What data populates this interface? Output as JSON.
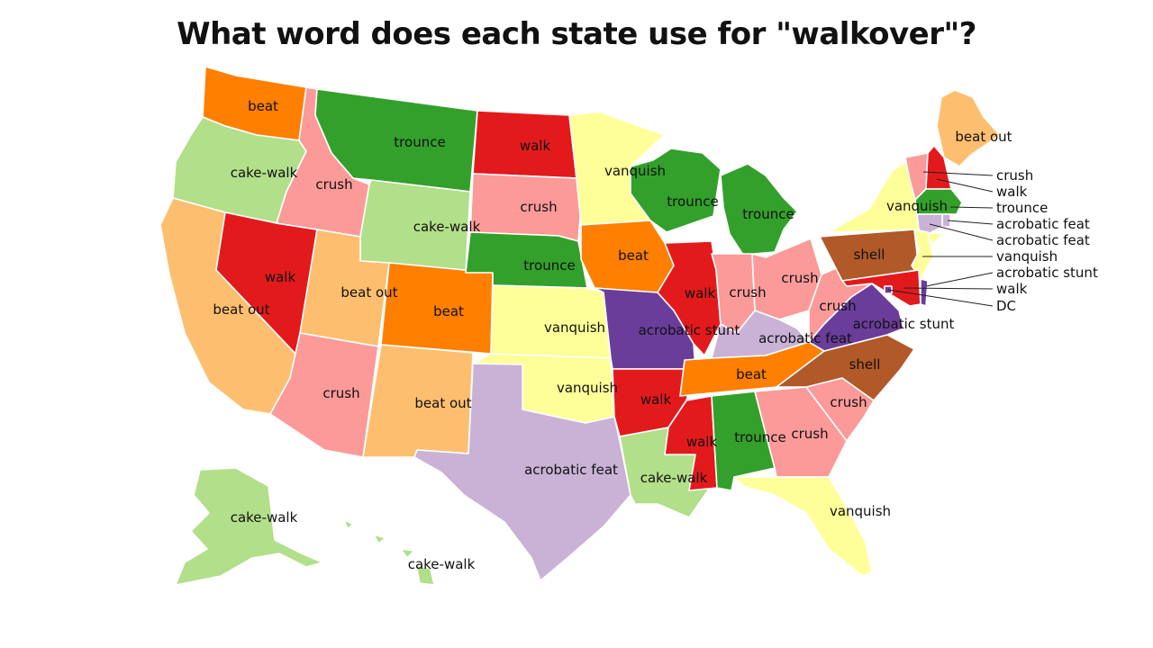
{
  "title": "What word does each state use for \"walkover\"?",
  "colors": {
    "beat": "#ff7f00",
    "beat out": "#fdbf6f",
    "cake-walk": "#b2df8a",
    "trounce": "#33a02c",
    "walk": "#e31a1c",
    "crush": "#fb9a99",
    "vanquish": "#ffff99",
    "acrobatic feat": "#cab2d6",
    "acrobatic stunt": "#6a3d9a",
    "shell": "#b15928"
  },
  "states": [
    {
      "code": "WA",
      "word": "beat"
    },
    {
      "code": "OR",
      "word": "cake-walk"
    },
    {
      "code": "CA",
      "word": "beat out"
    },
    {
      "code": "NV",
      "word": "walk"
    },
    {
      "code": "ID",
      "word": "crush"
    },
    {
      "code": "MT",
      "word": "trounce"
    },
    {
      "code": "WY",
      "word": "cake-walk"
    },
    {
      "code": "UT",
      "word": "beat out"
    },
    {
      "code": "AZ",
      "word": "crush"
    },
    {
      "code": "CO",
      "word": "beat"
    },
    {
      "code": "NM",
      "word": "beat out"
    },
    {
      "code": "ND",
      "word": "walk"
    },
    {
      "code": "SD",
      "word": "crush"
    },
    {
      "code": "NE",
      "word": "trounce"
    },
    {
      "code": "KS",
      "word": "vanquish"
    },
    {
      "code": "OK",
      "word": "vanquish"
    },
    {
      "code": "TX",
      "word": "acrobatic feat"
    },
    {
      "code": "MN",
      "word": "vanquish"
    },
    {
      "code": "IA",
      "word": "beat"
    },
    {
      "code": "MO",
      "word": "acrobatic stunt"
    },
    {
      "code": "AR",
      "word": "walk"
    },
    {
      "code": "LA",
      "word": "cake-walk"
    },
    {
      "code": "WI",
      "word": "trounce"
    },
    {
      "code": "IL",
      "word": "walk"
    },
    {
      "code": "MI",
      "word": "trounce"
    },
    {
      "code": "IN",
      "word": "crush"
    },
    {
      "code": "OH",
      "word": "crush"
    },
    {
      "code": "KY",
      "word": "acrobatic feat"
    },
    {
      "code": "TN",
      "word": "beat"
    },
    {
      "code": "MS",
      "word": "walk"
    },
    {
      "code": "AL",
      "word": "trounce"
    },
    {
      "code": "GA",
      "word": "crush"
    },
    {
      "code": "FL",
      "word": "vanquish"
    },
    {
      "code": "SC",
      "word": "crush"
    },
    {
      "code": "NC",
      "word": "shell"
    },
    {
      "code": "VA",
      "word": "acrobatic stunt"
    },
    {
      "code": "WV",
      "word": "crush"
    },
    {
      "code": "PA",
      "word": "shell"
    },
    {
      "code": "NY",
      "word": "vanquish"
    },
    {
      "code": "ME",
      "word": "beat out"
    },
    {
      "code": "VT",
      "word": "crush"
    },
    {
      "code": "NH",
      "word": "walk"
    },
    {
      "code": "MA",
      "word": "trounce"
    },
    {
      "code": "RI",
      "word": "acrobatic feat"
    },
    {
      "code": "CT",
      "word": "acrobatic feat"
    },
    {
      "code": "NJ",
      "word": "vanquish"
    },
    {
      "code": "DE",
      "word": "acrobatic stunt"
    },
    {
      "code": "MD",
      "word": "walk"
    },
    {
      "code": "DC",
      "word": "DC"
    },
    {
      "code": "AK",
      "word": "cake-walk"
    },
    {
      "code": "HI",
      "word": "cake-walk"
    }
  ],
  "side_labels": [
    "crush",
    "walk",
    "trounce",
    "acrobatic feat",
    "acrobatic feat",
    "vanquish",
    "acrobatic stunt",
    "walk",
    "DC"
  ]
}
